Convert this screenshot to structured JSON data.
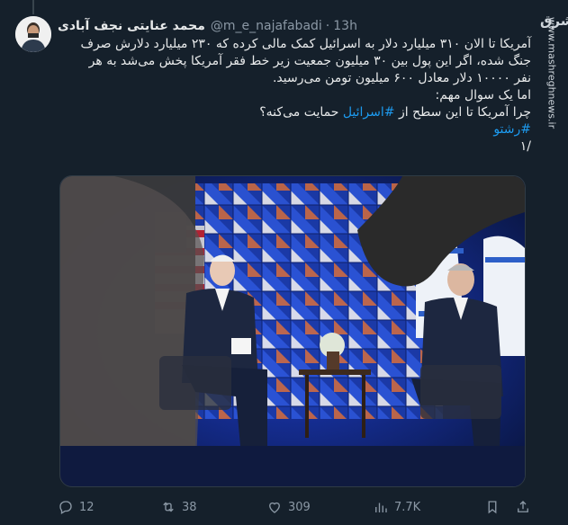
{
  "tweet": {
    "display_name": "محمد عنایتی نجف آبادی",
    "handle": "@m_e_najafabadi",
    "separator": "·",
    "time": "13h",
    "lines": [
      "آمریکا تا الان ۳۱۰ میلیارد دلار به اسرائیل کمک مالی کرده که ۲۳۰ میلیارد دلارش صرف",
      "جنگ شده، اگر این پول بین ۳۰ میلیون جمعیت زیر خط فقر آمریکا پخش می‌شد به هر",
      "نفر ۱۰۰۰۰ دلار معادل ۶۰۰ میلیون تومن می‌رسید.",
      "اما یک سوال مهم:"
    ],
    "question_before": "چرا آمریکا تا این سطح از ",
    "hashtag_israel": "#اسرائیل",
    "question_after": " حمایت می‌کنه؟",
    "hashtag_thread": "#رشتو",
    "thread_index": "/۱"
  },
  "watermark": {
    "logo": "مشرق",
    "url": "www.mashreghnews.ir"
  },
  "actions": {
    "replies": "12",
    "retweets": "38",
    "likes": "309",
    "views": "7.7K"
  },
  "colors": {
    "background": "#15202b",
    "link": "#1d9bf0",
    "muted": "#8b98a5",
    "text": "#e7e9ea"
  },
  "icons": [
    "reply-icon",
    "retweet-icon",
    "like-icon",
    "views-icon",
    "bookmark-icon",
    "share-icon"
  ]
}
